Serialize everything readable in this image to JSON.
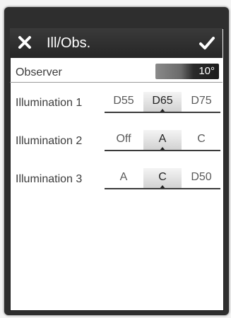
{
  "header": {
    "title": "Ill/Obs.",
    "close_icon": "close-icon",
    "confirm_icon": "check-icon"
  },
  "observer": {
    "label": "Observer",
    "value": "10°"
  },
  "illuminations": [
    {
      "label": "Illumination 1",
      "options": [
        "D55",
        "D65",
        "D75"
      ],
      "selected": 1
    },
    {
      "label": "Illumination 2",
      "options": [
        "Off",
        "A",
        "C"
      ],
      "selected": 1
    },
    {
      "label": "Illumination 3",
      "options": [
        "A",
        "C",
        "D50"
      ],
      "selected": 1
    }
  ]
}
